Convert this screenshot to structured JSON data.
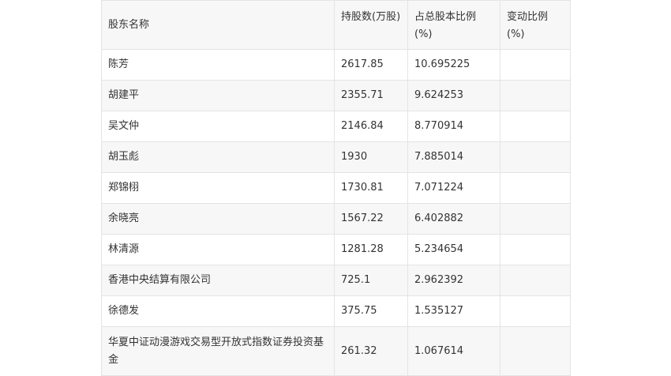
{
  "table": {
    "headers": [
      "股东名称",
      "持股数(万股)",
      "占总股本比例(%)",
      "变动比例(%)"
    ],
    "rows": [
      {
        "name": "陈芳",
        "shares": "2617.85",
        "ratio": "10.695225",
        "change": ""
      },
      {
        "name": "胡建平",
        "shares": "2355.71",
        "ratio": "9.624253",
        "change": ""
      },
      {
        "name": "吴文仲",
        "shares": "2146.84",
        "ratio": "8.770914",
        "change": ""
      },
      {
        "name": "胡玉彪",
        "shares": "1930",
        "ratio": "7.885014",
        "change": ""
      },
      {
        "name": "郑锦栩",
        "shares": "1730.81",
        "ratio": "7.071224",
        "change": ""
      },
      {
        "name": "余晓亮",
        "shares": "1567.22",
        "ratio": "6.402882",
        "change": ""
      },
      {
        "name": "林清源",
        "shares": "1281.28",
        "ratio": "5.234654",
        "change": ""
      },
      {
        "name": "香港中央结算有限公司",
        "shares": "725.1",
        "ratio": "2.962392",
        "change": ""
      },
      {
        "name": "徐德发",
        "shares": "375.75",
        "ratio": "1.535127",
        "change": ""
      },
      {
        "name": "华夏中证动漫游戏交易型开放式指数证券投资基金",
        "shares": "261.32",
        "ratio": "1.067614",
        "change": ""
      }
    ]
  }
}
